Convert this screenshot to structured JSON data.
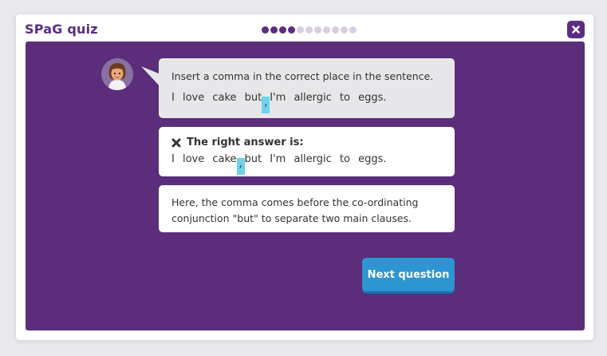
{
  "header": {
    "title": "SPaG quiz",
    "progress": {
      "total": 11,
      "completed": 4
    },
    "close_icon": "close-icon"
  },
  "question": {
    "prompt": "Insert a comma in the correct place in the sentence.",
    "sentence_before": "I love cake but",
    "sentence_after": "I'm allergic to eggs.",
    "selected_mark": ","
  },
  "answer": {
    "heading": "The right answer is:",
    "sentence_before": "I love cake",
    "sentence_after": "but I'm allergic to eggs.",
    "correct_mark": ",",
    "icon": "cross-icon"
  },
  "explanation": {
    "text_line1": "Here, the comma comes before the co-ordinating",
    "text_line2": "conjunction \"but\" to separate two main clauses."
  },
  "actions": {
    "next_label": "Next question"
  },
  "colors": {
    "brand": "#5b2d82",
    "panel": "#5b2d7a",
    "dot_done": "#5b2d82",
    "dot_pending": "#d9cde3",
    "highlight": "#6fd2ea",
    "button": "#2e95d3"
  }
}
